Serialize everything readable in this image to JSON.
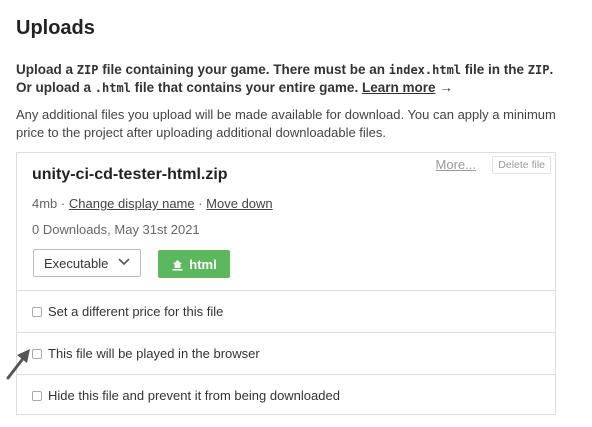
{
  "page": {
    "heading": "Uploads"
  },
  "intro": {
    "part1": "Upload a ",
    "code_zip": "ZIP",
    "part2": " file containing your game. There must be an ",
    "code_index": "index.html",
    "part3": " file in the ",
    "code_zip2": "ZIP",
    "part4": ".",
    "part5": "Or upload a ",
    "code_html": ".html",
    "part6": " file that contains your entire game. ",
    "learn_more": "Learn more",
    "arrow": " →"
  },
  "subtext": "Any additional files you upload will be made available for download. You can apply a minimum price to the project after uploading additional downloadable files.",
  "upload": {
    "more_label": "More...",
    "delete_label": "Delete file",
    "filename": "unity-ci-cd-tester-html.zip",
    "size": "4mb",
    "sep1": " · ",
    "change_display_name": "Change display name",
    "sep2": " · ",
    "move_down": "Move down",
    "downloads": "0 Downloads, May 31st 2021",
    "type_select": "Executable",
    "platform_button": "html",
    "options": [
      {
        "label": "Set a different price for this file",
        "checked": false
      },
      {
        "label": "This file will be played in the browser",
        "checked": false
      },
      {
        "label": "Hide this file and prevent it from being downloaded",
        "checked": false
      }
    ]
  },
  "colors": {
    "accent_green": "#5cb85c",
    "border": "#dddddd",
    "annotation_arrow": "#555555"
  },
  "icons": {
    "chevron": "chevron-down-icon",
    "platform": "html5-icon",
    "pointer": "annotation-arrow-icon"
  }
}
